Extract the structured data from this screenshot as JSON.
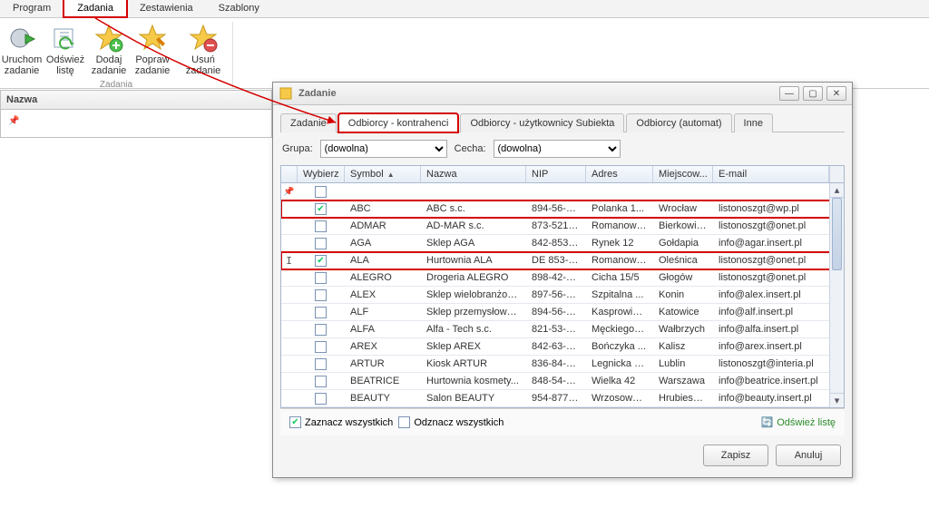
{
  "menu": {
    "items": [
      "Program",
      "Zadania",
      "Zestawienia",
      "Szablony"
    ],
    "active_index": 1
  },
  "ribbon": {
    "group_label": "Zadania",
    "buttons": [
      {
        "line1": "Uruchom",
        "line2": "zadanie"
      },
      {
        "line1": "Odśwież",
        "line2": "listę"
      },
      {
        "line1": "Dodaj",
        "line2": "zadanie"
      },
      {
        "line1": "Popraw",
        "line2": "zadanie"
      },
      {
        "line1": "Usuń zadanie",
        "line2": ""
      }
    ]
  },
  "left_panel": {
    "header": "Nazwa"
  },
  "dialog": {
    "title": "Zadanie",
    "tabs": [
      "Zadanie",
      "Odbiorcy - kontrahenci",
      "Odbiorcy - użytkownicy Subiekta",
      "Odbiorcy (automat)",
      "Inne"
    ],
    "active_tab_index": 1,
    "filter": {
      "grupa_label": "Grupa:",
      "grupa_value": "(dowolna)",
      "cecha_label": "Cecha:",
      "cecha_value": "(dowolna)"
    },
    "columns": [
      "Wybierz",
      "Symbol",
      "Nazwa",
      "NIP",
      "Adres",
      "Miejscow...",
      "E-mail"
    ],
    "rows": [
      {
        "ind": "",
        "checked": true,
        "symbol": "ABC",
        "nazwa": "ABC s.c.",
        "nip": "894-56-5...",
        "adres": "Polanka  1...",
        "miejs": "Wrocław",
        "email": "listonoszgt@wp.pl",
        "hl": true
      },
      {
        "ind": "",
        "checked": false,
        "symbol": "ADMAR",
        "nazwa": "AD-MAR s.c.",
        "nip": "873-521-...",
        "adres": "Romanows...",
        "miejs": "Bierkowice",
        "email": "listonoszgt@onet.pl"
      },
      {
        "ind": "",
        "checked": false,
        "symbol": "AGA",
        "nazwa": "Sklep AGA",
        "nip": "842-853-...",
        "adres": "Rynek 12",
        "miejs": "Gołdapia",
        "email": "info@agar.insert.pl"
      },
      {
        "ind": "I",
        "checked": true,
        "symbol": "ALA",
        "nazwa": "Hurtownia ALA",
        "nip": "DE 853-7...",
        "adres": "Romanows...",
        "miejs": "Oleśnica",
        "email": "listonoszgt@onet.pl",
        "hl": true
      },
      {
        "ind": "",
        "checked": false,
        "symbol": "ALEGRO",
        "nazwa": "Drogeria ALEGRO",
        "nip": "898-42-4...",
        "adres": "Cicha  15/5",
        "miejs": "Głogów",
        "email": "listonoszgt@onet.pl"
      },
      {
        "ind": "",
        "checked": false,
        "symbol": "ALEX",
        "nazwa": "Sklep wielobranżow...",
        "nip": "897-56-8...",
        "adres": "Szpitalna ...",
        "miejs": "Konin",
        "email": "info@alex.insert.pl"
      },
      {
        "ind": "",
        "checked": false,
        "symbol": "ALF",
        "nazwa": "Sklep przemysłowy ...",
        "nip": "894-56-8...",
        "adres": "Kasprowicz...",
        "miejs": "Katowice",
        "email": "info@alf.insert.pl"
      },
      {
        "ind": "",
        "checked": false,
        "symbol": "ALFA",
        "nazwa": "Alfa - Tech s.c.",
        "nip": "821-53-1...",
        "adres": "Męckiego  83",
        "miejs": "Wałbrzych",
        "email": "info@alfa.insert.pl"
      },
      {
        "ind": "",
        "checked": false,
        "symbol": "AREX",
        "nazwa": "Sklep AREX",
        "nip": "842-63-6...",
        "adres": "Bończyka ...",
        "miejs": "Kalisz",
        "email": "info@arex.insert.pl"
      },
      {
        "ind": "",
        "checked": false,
        "symbol": "ARTUR",
        "nazwa": "Kiosk ARTUR",
        "nip": "836-84-6...",
        "adres": "Legnicka  5...",
        "miejs": "Lublin",
        "email": "listonoszgt@interia.pl"
      },
      {
        "ind": "",
        "checked": false,
        "symbol": "BEATRICE",
        "nazwa": "Hurtownia kosmety...",
        "nip": "848-54-5...",
        "adres": "Wielka  42",
        "miejs": "Warszawa",
        "email": "info@beatrice.insert.pl"
      },
      {
        "ind": "",
        "checked": false,
        "symbol": "BEAUTY",
        "nazwa": "Salon BEAUTY",
        "nip": "954-877-...",
        "adres": "Wrzosowa ...",
        "miejs": "Hrubieszów",
        "email": "info@beauty.insert.pl"
      }
    ],
    "footer": {
      "select_all": "Zaznacz wszystkich",
      "deselect_all": "Odznacz wszystkich",
      "refresh": "Odśwież listę"
    },
    "buttons": {
      "save": "Zapisz",
      "cancel": "Anuluj"
    }
  }
}
